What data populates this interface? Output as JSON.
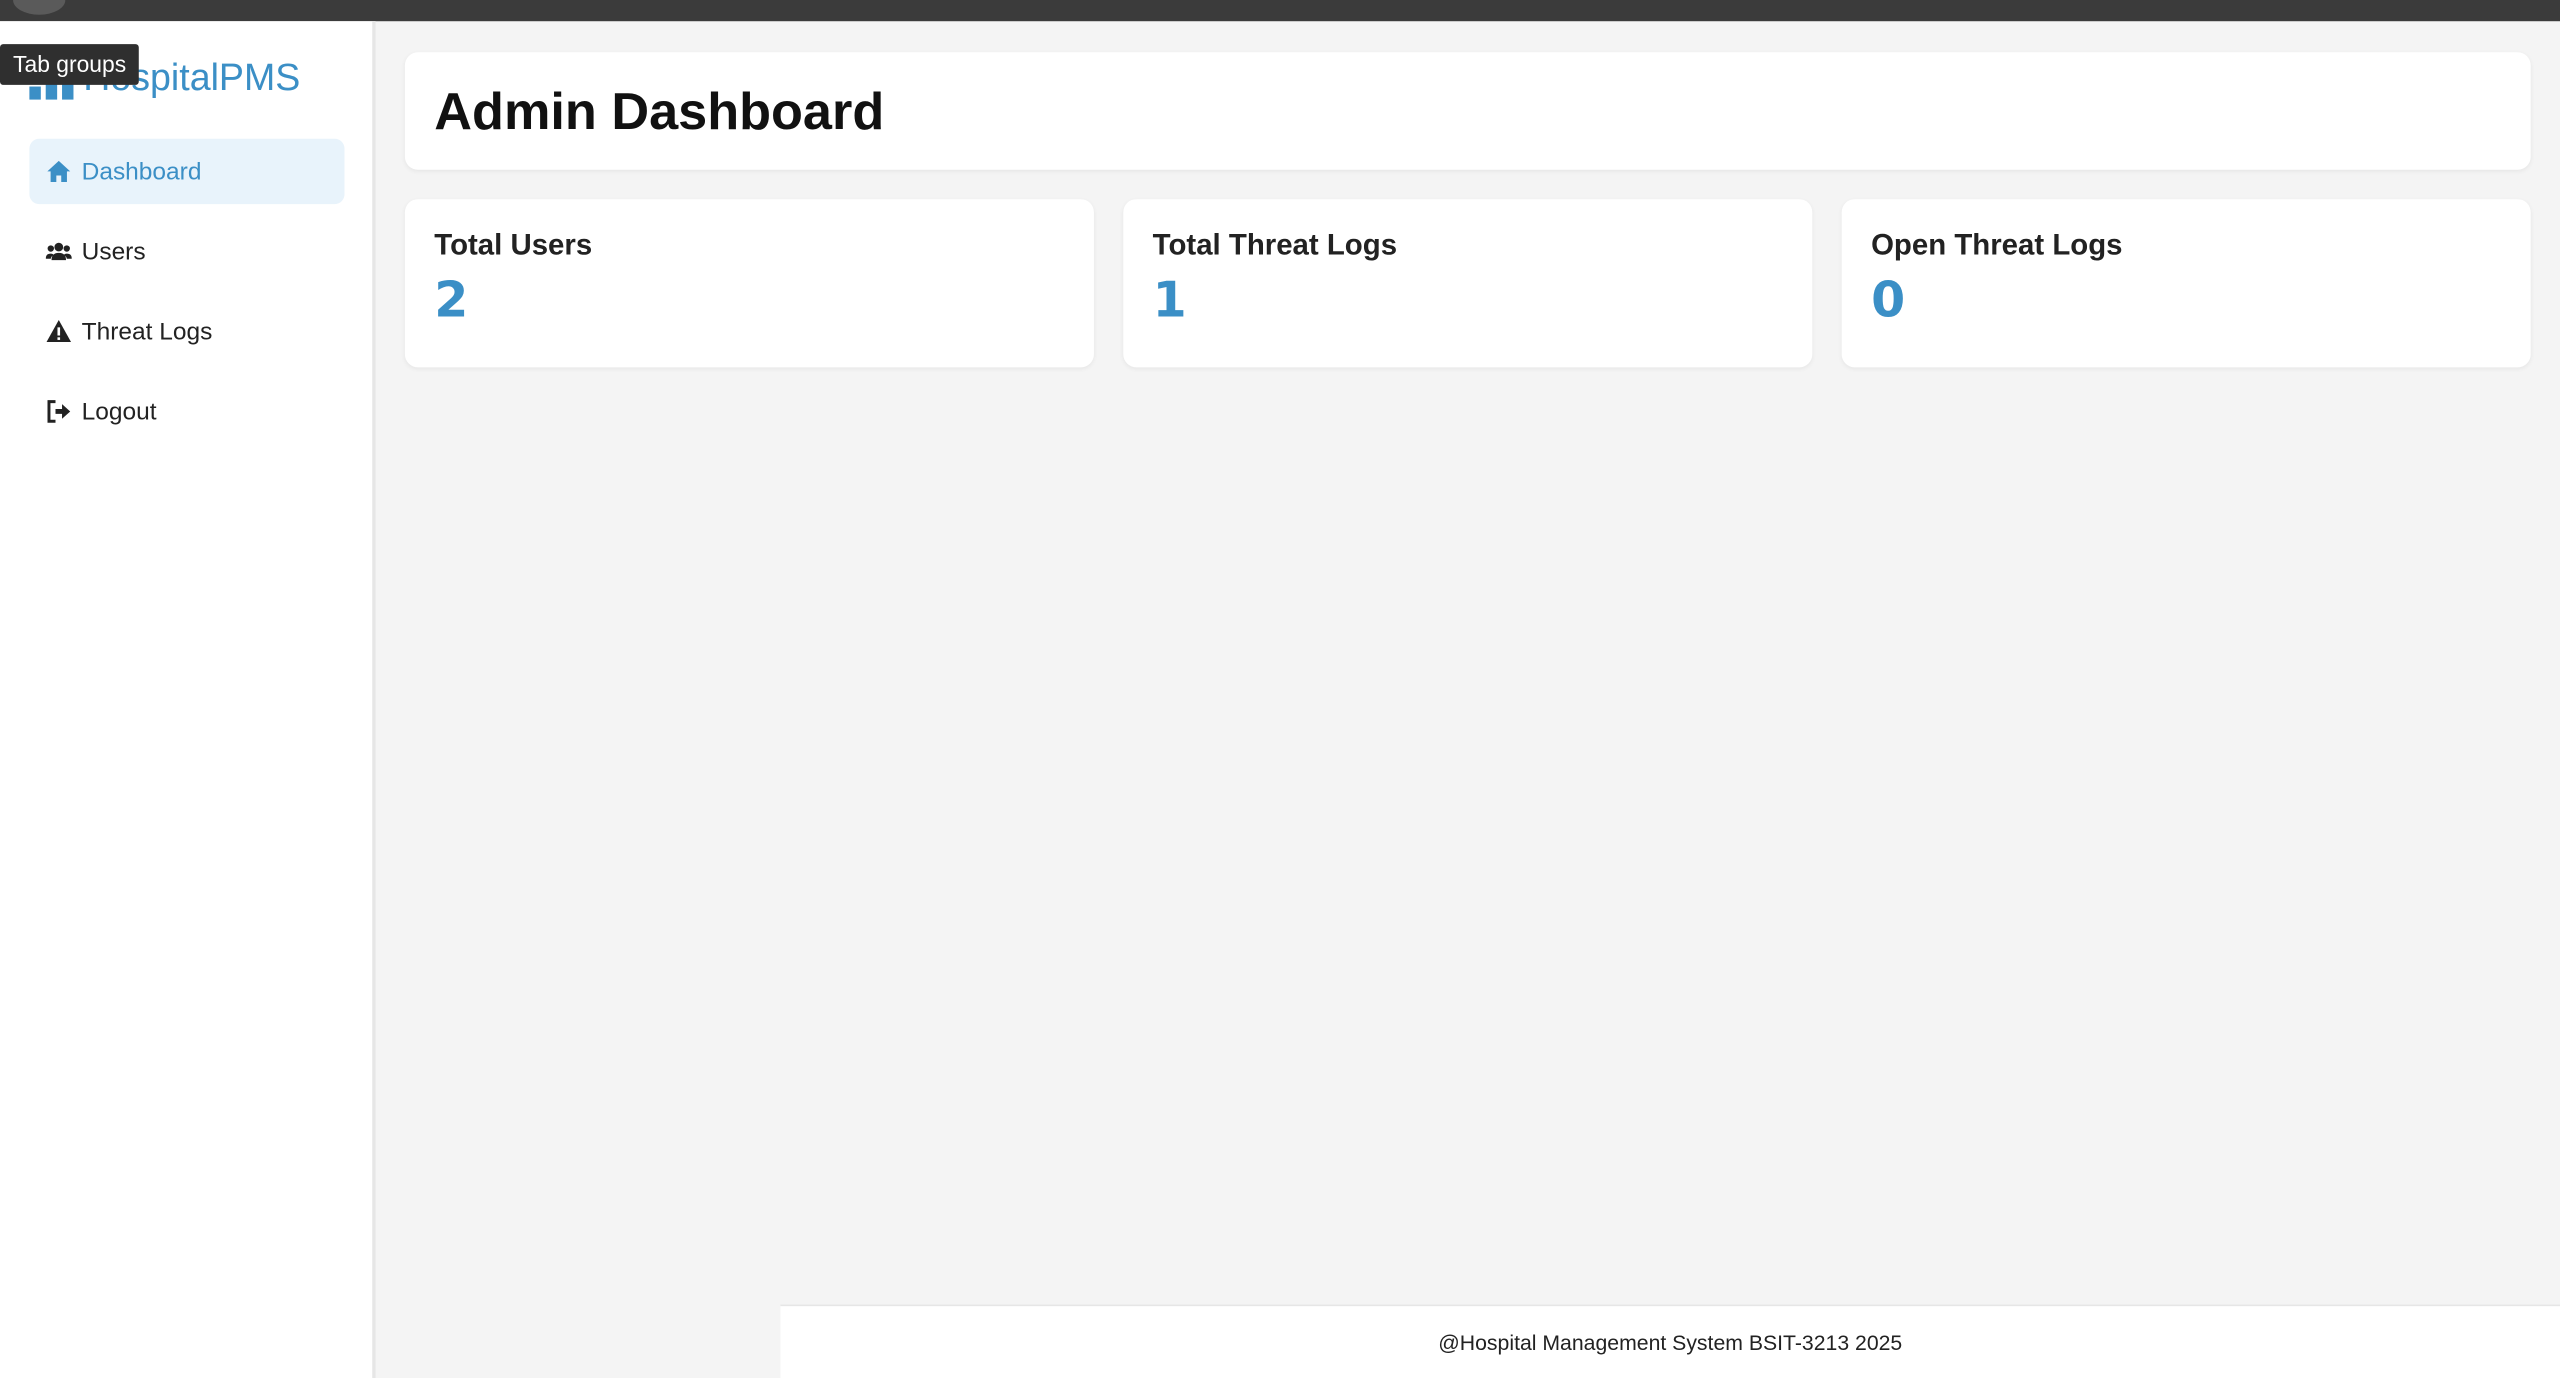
{
  "tooltip": {
    "text": "Tab groups"
  },
  "brand": {
    "name": "HospitalPMS"
  },
  "sidebar": {
    "items": [
      {
        "label": "Dashboard",
        "icon": "home-icon",
        "active": true
      },
      {
        "label": "Users",
        "icon": "users-icon",
        "active": false
      },
      {
        "label": "Threat Logs",
        "icon": "warning-icon",
        "active": false
      },
      {
        "label": "Logout",
        "icon": "logout-icon",
        "active": false
      }
    ]
  },
  "header": {
    "title": "Admin Dashboard"
  },
  "stats": [
    {
      "title": "Total Users",
      "value": "2"
    },
    {
      "title": "Total Threat Logs",
      "value": "1"
    },
    {
      "title": "Open Threat Logs",
      "value": "0"
    }
  ],
  "footer": {
    "text": "@Hospital Management System BSIT-3213 2025"
  },
  "colors": {
    "accent": "#3b8fc6",
    "active_bg": "#e8f3fb",
    "page_bg": "#f4f4f4"
  }
}
